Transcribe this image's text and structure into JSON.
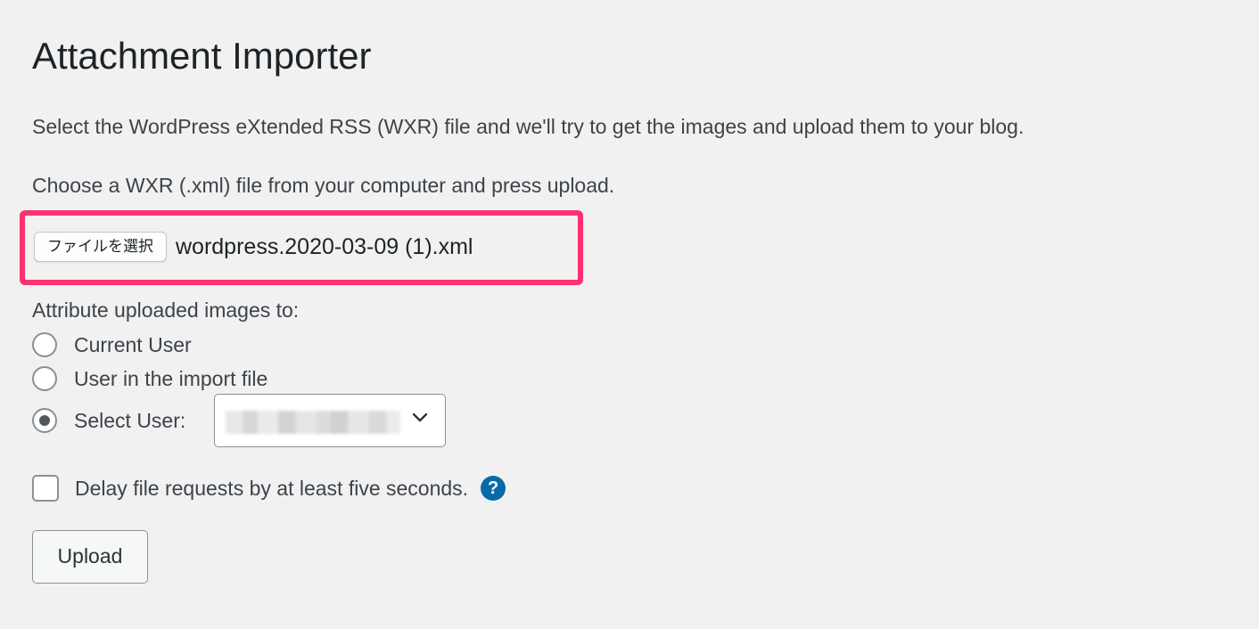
{
  "page": {
    "title": "Attachment Importer",
    "description": "Select the WordPress eXtended RSS (WXR) file and we'll try to get the images and upload them to your blog.",
    "instruction": "Choose a WXR (.xml) file from your computer and press upload."
  },
  "file_input": {
    "button_label": "ファイルを選択",
    "selected_file": "wordpress.2020-03-09 (1).xml",
    "highlight_color": "#ff3070"
  },
  "attribution": {
    "label": "Attribute uploaded images to:",
    "options": [
      {
        "label": "Current User",
        "checked": false
      },
      {
        "label": "User in the import file",
        "checked": false
      },
      {
        "label": "Select User:",
        "checked": true
      }
    ],
    "select_user": {
      "value": "",
      "value_obscured": true,
      "icon": "chevron-down-icon"
    }
  },
  "delay": {
    "label": "Delay file requests by at least five seconds.",
    "checked": false,
    "help_icon": "?",
    "help_color": "#0a6aa8"
  },
  "upload": {
    "label": "Upload"
  }
}
